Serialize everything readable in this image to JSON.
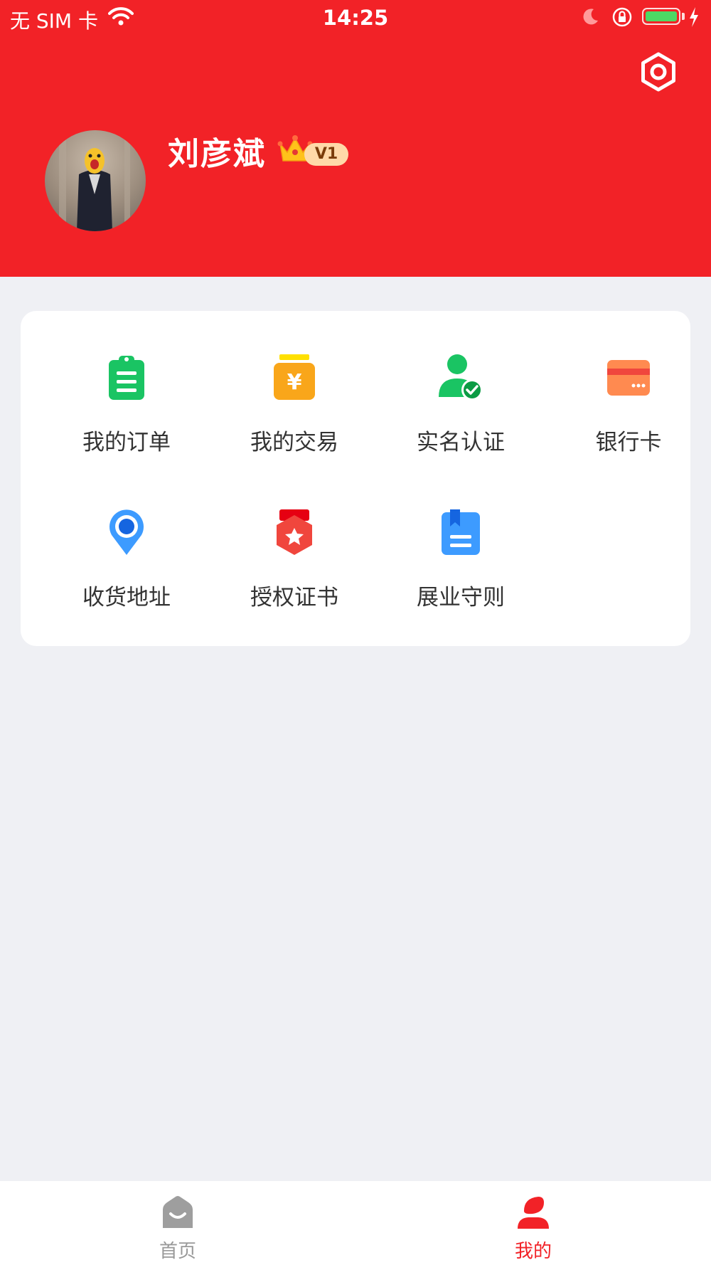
{
  "status_bar": {
    "carrier": "无 SIM 卡",
    "time": "14:25",
    "battery_level": 1.0
  },
  "profile": {
    "name": "刘彦斌",
    "level": "V1"
  },
  "menu": {
    "items": [
      {
        "label": "我的订单",
        "icon": "order-clipboard-icon",
        "color": "#1ac463"
      },
      {
        "label": "我的交易",
        "icon": "yuan-jar-icon",
        "color": "#f9a61a"
      },
      {
        "label": "实名认证",
        "icon": "verified-user-icon",
        "color": "#1ac463"
      },
      {
        "label": "银行卡",
        "icon": "bank-card-icon",
        "color": "#ff8a50"
      },
      {
        "label": "收货地址",
        "icon": "location-pin-icon",
        "color": "#3d9bff"
      },
      {
        "label": "授权证书",
        "icon": "certificate-medal-icon",
        "color": "#f0463d"
      },
      {
        "label": "展业守则",
        "icon": "rulebook-icon",
        "color": "#3d9bff"
      }
    ]
  },
  "tabbar": {
    "tabs": [
      {
        "label": "首页",
        "icon": "home-icon",
        "active": false
      },
      {
        "label": "我的",
        "icon": "profile-icon",
        "active": true
      }
    ]
  },
  "colors": {
    "brand_red": "#f22227",
    "active_tab": "#f22227",
    "inactive_tab": "#999999",
    "page_background": "#eff0f4"
  }
}
